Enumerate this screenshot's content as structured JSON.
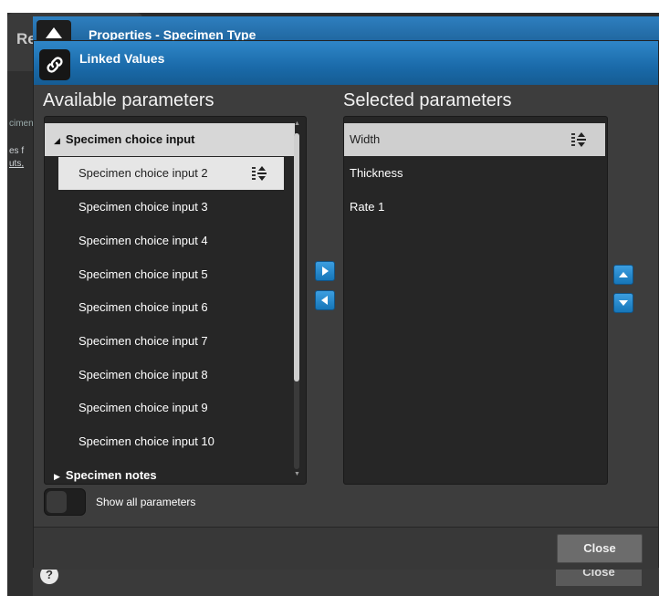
{
  "background": {
    "tab_text": "Re",
    "snippet_1": "cimen",
    "snippet_2": "es f",
    "snippet_3": "uts,",
    "help_glyph": "?",
    "close_label": "Close"
  },
  "parent_dialog": {
    "title": "Properties - Specimen Type"
  },
  "dialog": {
    "title": "Linked Values",
    "available": {
      "title": "Available parameters",
      "groups": [
        {
          "label": "Specimen choice input",
          "expanded": true,
          "items": [
            "Specimen choice input  2",
            "Specimen choice input  3",
            "Specimen choice input  4",
            "Specimen choice input  5",
            "Specimen choice input  6",
            "Specimen choice input  7",
            "Specimen choice input  8",
            "Specimen choice input  9",
            "Specimen choice input 10"
          ],
          "selected_item": "Specimen choice input  2"
        },
        {
          "label": "Specimen notes",
          "expanded": false
        }
      ]
    },
    "selected": {
      "title": "Selected parameters",
      "items": [
        "Width",
        "Thickness",
        "Rate 1"
      ],
      "selected_item": "Width"
    },
    "toggle_label": "Show all parameters",
    "toggle_on": false,
    "close_label": "Close",
    "colors": {
      "header_blue": "#1a6aa9",
      "button_blue": "#1676b8",
      "panel_bg": "#262626",
      "dialog_bg": "#3d3d3d"
    }
  }
}
